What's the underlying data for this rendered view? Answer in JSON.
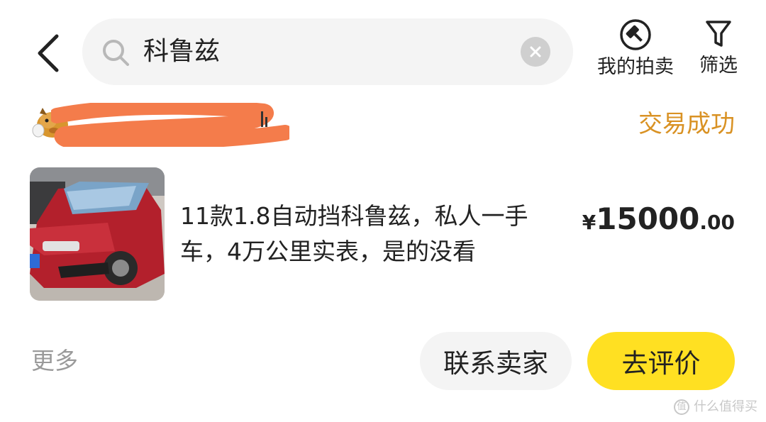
{
  "search": {
    "query": "科鲁兹"
  },
  "actions": {
    "auction_label": "我的拍卖",
    "filter_label": "筛选"
  },
  "order": {
    "status": "交易成功",
    "title": "11款1.8自动挡科鲁兹，私人一手车，4万公里实表，是的没看",
    "price_symbol": "¥",
    "price_integer": "15000",
    "price_decimal": ".00"
  },
  "footer": {
    "more_label": "更多",
    "contact_label": "联系卖家",
    "review_label": "去评价"
  },
  "watermark": {
    "text": "什么值得买"
  },
  "colors": {
    "status_orange": "#d99224",
    "primary_yellow": "#ffe022",
    "redaction": "#f47c4b"
  },
  "icons": [
    "back-arrow-icon",
    "search-icon",
    "clear-icon",
    "auction-hammer-icon",
    "filter-funnel-icon",
    "seller-avatar-icon"
  ]
}
